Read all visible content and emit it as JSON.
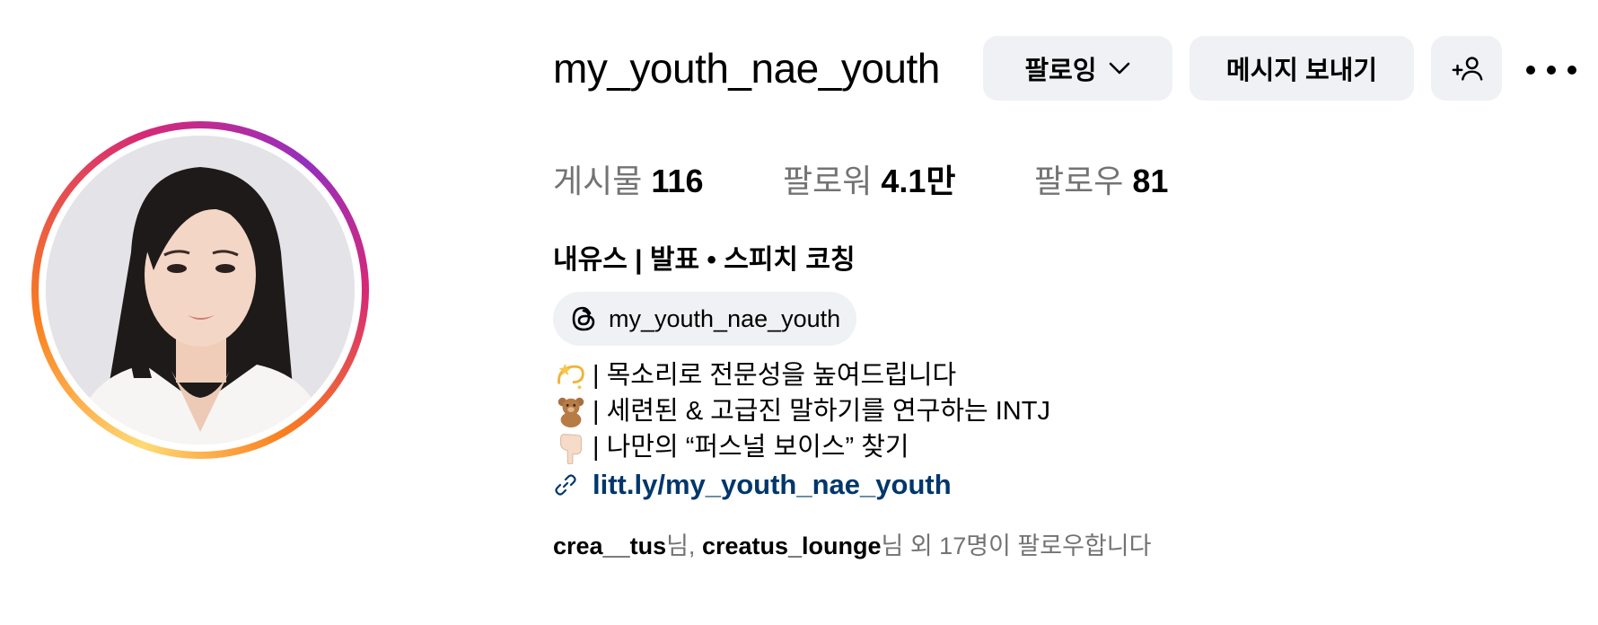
{
  "profile": {
    "username": "my_youth_nae_youth",
    "full_name": "내유스 | 발표 • 스피치 코칭",
    "avatar_alt": "profile-photo"
  },
  "actions": {
    "follow_label": "팔로잉",
    "message_label": "메시지 보내기",
    "add_user_label": "+",
    "more_label": "..."
  },
  "stats": {
    "posts_label": "게시물",
    "posts_value": "116",
    "followers_label": "팔로워",
    "followers_value": "4.1만",
    "following_label": "팔로우",
    "following_value": "81"
  },
  "threads": {
    "handle": "my_youth_nae_youth"
  },
  "bio": {
    "lines": [
      {
        "emoji": "dizzy-star-icon",
        "text": "| 목소리로 전문성을 높여드립니다"
      },
      {
        "emoji": "teddy-bear-icon",
        "text": "| 세련된 & 고급진 말하기를 연구하는 INTJ"
      },
      {
        "emoji": "pointing-hand-icon",
        "text": "| 나만의 “퍼스널 보이스” 찾기"
      }
    ],
    "link": "litt.ly/my_youth_nae_youth"
  },
  "followed_by": {
    "user1": "crea__tus",
    "sep1": "님, ",
    "user2": "creatus_lounge",
    "suffix": "님 외 17명이 팔로우합니다"
  },
  "colors": {
    "button_bg": "#eff1f4",
    "link": "#00376b",
    "muted": "#737373",
    "ring_start": "#feda75",
    "ring_end": "#d62976"
  }
}
